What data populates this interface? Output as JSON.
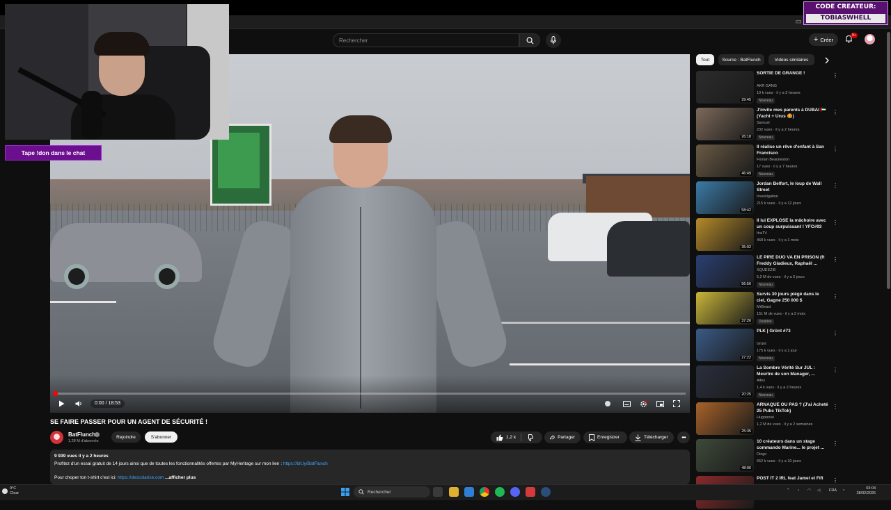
{
  "overlay": {
    "chat_banner": "Tape !don dans le chat",
    "creator_code_label": "CODE CREATEUR:",
    "creator_code_value": "TOBIASWHELL"
  },
  "header": {
    "search_placeholder": "Rechercher",
    "create_label": "Créer",
    "notification_count": "9+"
  },
  "player": {
    "time": "0:00 / 18:53",
    "progress": 0.0
  },
  "video": {
    "title": "SE FAIRE PASSER POUR UN AGENT DE SÉCURITÉ !",
    "channel": "BatFlunch",
    "subscribers": "1,28 M d'abonnés",
    "join_label": "Rejoindre",
    "subscribe_label": "S'abonner",
    "likes": "1,2 k",
    "share_label": "Partager",
    "save_label": "Enregistrer",
    "download_label": "Télécharger"
  },
  "description": {
    "meta": "9 939 vues  il y a 2 heures",
    "line1_text": "Profitez d'un essai gratuit de 14 jours ainsi que de toutes les fonctionnalités offertes par MyHeritage sur mon lien : ",
    "line1_link": "https://bit.ly/BatFlunch",
    "line2_text": "Pour choper ton t-shirt c'est ici: ",
    "line2_link": "https://descolarise.com",
    "more_label": " ...afficher plus"
  },
  "chips": [
    "Tout",
    "Source : BatFlunch",
    "Vidéos similaires"
  ],
  "recommendations": [
    {
      "title": "SORTIE DE GRANGE !",
      "channel": "AKR GANG",
      "stats": "10 k vues  · il y a 3 heures",
      "badge": "Nouveau",
      "duration": "29:45",
      "color": "#2c2c2c"
    },
    {
      "title": "J'invite mes parents à DUBAI 🇦🇪 (Yacht + Urus 🤩)",
      "channel": "Samuel",
      "stats": "232 vues  · il y a 2 heures",
      "badge": "Nouveau",
      "duration": "26:18",
      "color": "#7d6a5a"
    },
    {
      "title": "Il réalise un rêve d'enfant à San Francisco",
      "channel": "Florian Beaulieston",
      "stats": "17 vues  · il y a 7 heures",
      "badge": "Nouveau",
      "duration": "46:49",
      "color": "#6a5a44"
    },
    {
      "title": "Jordan Belfort, le loup de Wall Street",
      "channel": "Investigation",
      "stats": "215 k vues  · il y a 12 jours",
      "badge": "",
      "duration": "58:42",
      "color": "#3b7ba8"
    },
    {
      "title": "Il lui EXPLOSE la mâchoire avec un coup surpuissant ! YFC#93",
      "channel": "ItraTV",
      "stats": "468 k vues  · il y a 1 mois",
      "badge": "",
      "duration": "35:02",
      "color": "#b58a2a"
    },
    {
      "title": "LE PIRE DUO VA EN PRISON (ft Freddy Gladieux, Raphaël ...",
      "channel": "SQUEEZIE",
      "stats": "5,2 M de vues  · il y a 5 jours",
      "badge": "Nouveau",
      "duration": "56:56",
      "color": "#2a3f72"
    },
    {
      "title": "Survis 30 jours piégé dans le ciel, Gagne 250 000 $",
      "channel": "MrBeast",
      "stats": "151 M de vues  · il y a 2 mois",
      "badge": "Doublée",
      "duration": "37:26",
      "color": "#c9b63a"
    },
    {
      "title": "PLK | Grünt #73",
      "channel": "Grünt",
      "stats": "175 k vues  · il y a 1 jour",
      "badge": "Nouveau",
      "duration": "27:22",
      "color": "#3a5a86"
    },
    {
      "title": "La Sombre Vérité Sur JUL : Meurtre de son Manager, ...",
      "channel": "Alfex",
      "stats": "1,4 k vues  · il y a 2 heures",
      "badge": "Nouveau",
      "duration": "20:25",
      "color": "#2a2f3d"
    },
    {
      "title": "ARNAQUE OU PAS ? (J'ai Acheté 25 Pubs TikTok)",
      "channel": "Hugoposé",
      "stats": "1,2 M de vues  · il y a 2 semaines",
      "badge": "",
      "duration": "25:35",
      "color": "#a8632a"
    },
    {
      "title": "10 créateurs dans un stage commando Marine... le projet ...",
      "channel": "Diego",
      "stats": "652 k vues  · il y a 10 jours",
      "badge": "",
      "duration": "48:06",
      "color": "#3e4a3a"
    },
    {
      "title": "POST IT 2 IRL feat Jamel et Fifi",
      "channel": "",
      "stats": "",
      "badge": "",
      "duration": "",
      "color": "#8a2a2a"
    }
  ],
  "taskbar": {
    "weather_temp": "9°C",
    "weather_desc": "Clear",
    "search_label": "Rechercher",
    "lang": "FRA",
    "time": "03:04",
    "date": "28/02/2026"
  },
  "colors": {
    "accent_red": "#ff0000",
    "banner_purple": "#6b0f8e",
    "link_blue": "#3ea6ff"
  }
}
